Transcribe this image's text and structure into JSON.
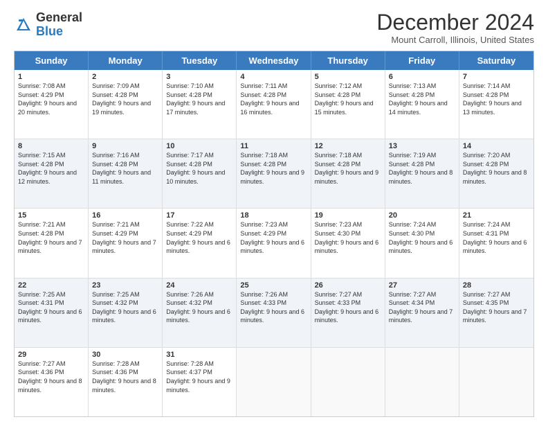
{
  "header": {
    "logo_general": "General",
    "logo_blue": "Blue",
    "month_title": "December 2024",
    "location": "Mount Carroll, Illinois, United States"
  },
  "days_of_week": [
    "Sunday",
    "Monday",
    "Tuesday",
    "Wednesday",
    "Thursday",
    "Friday",
    "Saturday"
  ],
  "weeks": [
    {
      "alt": false,
      "cells": [
        {
          "day": "1",
          "sunrise": "Sunrise: 7:08 AM",
          "sunset": "Sunset: 4:29 PM",
          "daylight": "Daylight: 9 hours and 20 minutes."
        },
        {
          "day": "2",
          "sunrise": "Sunrise: 7:09 AM",
          "sunset": "Sunset: 4:28 PM",
          "daylight": "Daylight: 9 hours and 19 minutes."
        },
        {
          "day": "3",
          "sunrise": "Sunrise: 7:10 AM",
          "sunset": "Sunset: 4:28 PM",
          "daylight": "Daylight: 9 hours and 17 minutes."
        },
        {
          "day": "4",
          "sunrise": "Sunrise: 7:11 AM",
          "sunset": "Sunset: 4:28 PM",
          "daylight": "Daylight: 9 hours and 16 minutes."
        },
        {
          "day": "5",
          "sunrise": "Sunrise: 7:12 AM",
          "sunset": "Sunset: 4:28 PM",
          "daylight": "Daylight: 9 hours and 15 minutes."
        },
        {
          "day": "6",
          "sunrise": "Sunrise: 7:13 AM",
          "sunset": "Sunset: 4:28 PM",
          "daylight": "Daylight: 9 hours and 14 minutes."
        },
        {
          "day": "7",
          "sunrise": "Sunrise: 7:14 AM",
          "sunset": "Sunset: 4:28 PM",
          "daylight": "Daylight: 9 hours and 13 minutes."
        }
      ]
    },
    {
      "alt": true,
      "cells": [
        {
          "day": "8",
          "sunrise": "Sunrise: 7:15 AM",
          "sunset": "Sunset: 4:28 PM",
          "daylight": "Daylight: 9 hours and 12 minutes."
        },
        {
          "day": "9",
          "sunrise": "Sunrise: 7:16 AM",
          "sunset": "Sunset: 4:28 PM",
          "daylight": "Daylight: 9 hours and 11 minutes."
        },
        {
          "day": "10",
          "sunrise": "Sunrise: 7:17 AM",
          "sunset": "Sunset: 4:28 PM",
          "daylight": "Daylight: 9 hours and 10 minutes."
        },
        {
          "day": "11",
          "sunrise": "Sunrise: 7:18 AM",
          "sunset": "Sunset: 4:28 PM",
          "daylight": "Daylight: 9 hours and 9 minutes."
        },
        {
          "day": "12",
          "sunrise": "Sunrise: 7:18 AM",
          "sunset": "Sunset: 4:28 PM",
          "daylight": "Daylight: 9 hours and 9 minutes."
        },
        {
          "day": "13",
          "sunrise": "Sunrise: 7:19 AM",
          "sunset": "Sunset: 4:28 PM",
          "daylight": "Daylight: 9 hours and 8 minutes."
        },
        {
          "day": "14",
          "sunrise": "Sunrise: 7:20 AM",
          "sunset": "Sunset: 4:28 PM",
          "daylight": "Daylight: 9 hours and 8 minutes."
        }
      ]
    },
    {
      "alt": false,
      "cells": [
        {
          "day": "15",
          "sunrise": "Sunrise: 7:21 AM",
          "sunset": "Sunset: 4:28 PM",
          "daylight": "Daylight: 9 hours and 7 minutes."
        },
        {
          "day": "16",
          "sunrise": "Sunrise: 7:21 AM",
          "sunset": "Sunset: 4:29 PM",
          "daylight": "Daylight: 9 hours and 7 minutes."
        },
        {
          "day": "17",
          "sunrise": "Sunrise: 7:22 AM",
          "sunset": "Sunset: 4:29 PM",
          "daylight": "Daylight: 9 hours and 6 minutes."
        },
        {
          "day": "18",
          "sunrise": "Sunrise: 7:23 AM",
          "sunset": "Sunset: 4:29 PM",
          "daylight": "Daylight: 9 hours and 6 minutes."
        },
        {
          "day": "19",
          "sunrise": "Sunrise: 7:23 AM",
          "sunset": "Sunset: 4:30 PM",
          "daylight": "Daylight: 9 hours and 6 minutes."
        },
        {
          "day": "20",
          "sunrise": "Sunrise: 7:24 AM",
          "sunset": "Sunset: 4:30 PM",
          "daylight": "Daylight: 9 hours and 6 minutes."
        },
        {
          "day": "21",
          "sunrise": "Sunrise: 7:24 AM",
          "sunset": "Sunset: 4:31 PM",
          "daylight": "Daylight: 9 hours and 6 minutes."
        }
      ]
    },
    {
      "alt": true,
      "cells": [
        {
          "day": "22",
          "sunrise": "Sunrise: 7:25 AM",
          "sunset": "Sunset: 4:31 PM",
          "daylight": "Daylight: 9 hours and 6 minutes."
        },
        {
          "day": "23",
          "sunrise": "Sunrise: 7:25 AM",
          "sunset": "Sunset: 4:32 PM",
          "daylight": "Daylight: 9 hours and 6 minutes."
        },
        {
          "day": "24",
          "sunrise": "Sunrise: 7:26 AM",
          "sunset": "Sunset: 4:32 PM",
          "daylight": "Daylight: 9 hours and 6 minutes."
        },
        {
          "day": "25",
          "sunrise": "Sunrise: 7:26 AM",
          "sunset": "Sunset: 4:33 PM",
          "daylight": "Daylight: 9 hours and 6 minutes."
        },
        {
          "day": "26",
          "sunrise": "Sunrise: 7:27 AM",
          "sunset": "Sunset: 4:33 PM",
          "daylight": "Daylight: 9 hours and 6 minutes."
        },
        {
          "day": "27",
          "sunrise": "Sunrise: 7:27 AM",
          "sunset": "Sunset: 4:34 PM",
          "daylight": "Daylight: 9 hours and 7 minutes."
        },
        {
          "day": "28",
          "sunrise": "Sunrise: 7:27 AM",
          "sunset": "Sunset: 4:35 PM",
          "daylight": "Daylight: 9 hours and 7 minutes."
        }
      ]
    },
    {
      "alt": false,
      "cells": [
        {
          "day": "29",
          "sunrise": "Sunrise: 7:27 AM",
          "sunset": "Sunset: 4:36 PM",
          "daylight": "Daylight: 9 hours and 8 minutes."
        },
        {
          "day": "30",
          "sunrise": "Sunrise: 7:28 AM",
          "sunset": "Sunset: 4:36 PM",
          "daylight": "Daylight: 9 hours and 8 minutes."
        },
        {
          "day": "31",
          "sunrise": "Sunrise: 7:28 AM",
          "sunset": "Sunset: 4:37 PM",
          "daylight": "Daylight: 9 hours and 9 minutes."
        },
        {
          "day": "",
          "sunrise": "",
          "sunset": "",
          "daylight": ""
        },
        {
          "day": "",
          "sunrise": "",
          "sunset": "",
          "daylight": ""
        },
        {
          "day": "",
          "sunrise": "",
          "sunset": "",
          "daylight": ""
        },
        {
          "day": "",
          "sunrise": "",
          "sunset": "",
          "daylight": ""
        }
      ]
    }
  ]
}
